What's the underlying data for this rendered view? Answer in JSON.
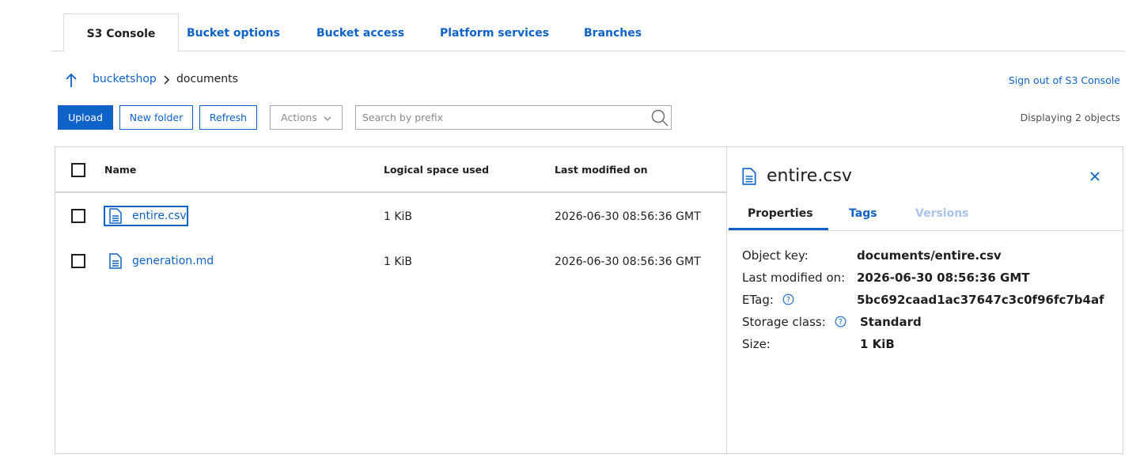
{
  "colors": {
    "accent": "#0f62c8",
    "border": "#d4d4d4"
  },
  "tabs": [
    "S3 Console",
    "Bucket options",
    "Bucket access",
    "Platform services",
    "Branches"
  ],
  "breadcrumb": {
    "up_icon": "arrow-up-icon",
    "root": "bucketshop",
    "current": "documents"
  },
  "signout_label": "Sign out of S3 Console",
  "toolbar": {
    "upload_label": "Upload",
    "new_folder_label": "New folder",
    "refresh_label": "Refresh",
    "actions_label": "Actions",
    "search_placeholder": "Search by prefix",
    "search_value": ""
  },
  "object_count": "Displaying 2 objects",
  "table": {
    "columns": [
      "Name",
      "Logical space used",
      "Last modified on"
    ],
    "rows": [
      {
        "name": "entire.csv",
        "size": "1 KiB",
        "modified": "2026-06-30 08:56:36 GMT"
      },
      {
        "name": "generation.md",
        "size": "1 KiB",
        "modified": "2026-06-30 08:56:36 GMT"
      }
    ]
  },
  "details": {
    "title": "entire.csv",
    "tabs": [
      "Properties",
      "Tags",
      "Versions"
    ],
    "properties": [
      {
        "key": "Object key:",
        "value": "documents/entire.csv"
      },
      {
        "key": "Last modified on:",
        "value": "2026-06-30 08:56:36 GMT"
      },
      {
        "key": "ETag:",
        "value": "5bc692caad1ac37647c3c0f96fc7b4af"
      },
      {
        "key": "Storage class:",
        "value": "Standard"
      },
      {
        "key": "Size:",
        "value": "1 KiB"
      }
    ]
  }
}
